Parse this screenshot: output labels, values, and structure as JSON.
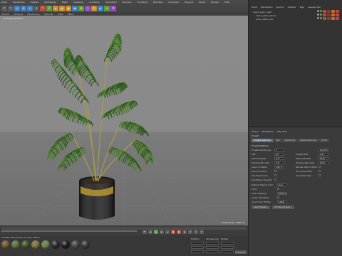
{
  "menubar": [
    "Datei",
    "Bearbeiten",
    "Objekte",
    "Werkzeuge",
    "Mesh",
    "Snapping",
    "Animation",
    "Simulation",
    "Rendern",
    "Sculpting",
    "MoGraph",
    "Charakter",
    "Plug-ins",
    "Skript",
    "Fenster",
    "Hilfe"
  ],
  "toolbar": [
    "↶",
    "↷",
    "◎",
    "✥",
    "⟲",
    "✕",
    "Y",
    "Z",
    "◈",
    "▦",
    "▣",
    "◆",
    "✿",
    "⬡",
    "⚙",
    "◐",
    "✦",
    "⚑"
  ],
  "viewport": {
    "menu": [
      "Ansicht",
      "Kameras",
      "Darstellung",
      "Optionen",
      "Filter",
      "Tafeln"
    ],
    "label": "Zentralperspektive",
    "status": "Rasterweite: 1000 cm"
  },
  "object_manager": {
    "menu": [
      "Datei",
      "Bearbeiten",
      "Ansicht",
      "Objekte",
      "Tags",
      "Lesezeichen"
    ],
    "items": [
      {
        "name": "areca_palm_plant"
      },
      {
        "name": "areca_palm_leaves"
      },
      {
        "name": "areca_palm_pot"
      }
    ]
  },
  "attributes": {
    "menu": [
      "Modus",
      "Bearbeiten",
      "Benutzer"
    ],
    "title": "Projekt",
    "tabs": [
      "Projekt-Settings",
      "Info",
      "Dynamics",
      "Referenzierung",
      "To Do"
    ],
    "section": "Projekt-Settings",
    "fields_left": [
      {
        "label": "Projekt-Skalierung",
        "value": "1"
      },
      {
        "label": "FPS",
        "value": "30"
      },
      {
        "label": "Minimale Zeit",
        "value": "0 B"
      },
      {
        "label": "Preview-Min-Zeit",
        "value": "0 B"
      },
      {
        "label": "Level of Detail",
        "value": "100 %"
      },
      {
        "label": "Use Animation",
        "value": ""
      },
      {
        "label": "Use Expression",
        "value": ""
      },
      {
        "label": "Use Motion System",
        "value": ""
      }
    ],
    "fields_right": [
      {
        "label": "",
        "value": "Zentimeter"
      },
      {
        "label": "Projekt-Zeit",
        "value": "0 B"
      },
      {
        "label": "Maximale Zeit",
        "value": "90 B"
      },
      {
        "label": "Preview-Max-Zeit",
        "value": "90 B"
      },
      {
        "label": "Render-LOD in Editor",
        "value": ""
      },
      {
        "label": "Use Generators",
        "value": ""
      },
      {
        "label": "Use Deformers",
        "value": ""
      },
      {
        "label": "",
        "value": ""
      }
    ],
    "extra_fields": [
      {
        "label": "Default Object Color",
        "value": "Grau 80%"
      },
      {
        "label": "Color",
        "value": ""
      },
      {
        "label": "View Clipping",
        "value": "Medium"
      },
      {
        "label": "Linear Workflow",
        "value": ""
      },
      {
        "label": "Input Color Profile",
        "value": "sRGB"
      }
    ],
    "buttons": [
      "Lade Preset...",
      "Sichere Preset..."
    ]
  },
  "materials": {
    "menu": [
      "Erstellen",
      "Bearbeiten",
      "Funktion",
      "Textur"
    ],
    "swatches": [
      "#7a5a2a",
      "#5f7a3a",
      "#3f5a2a",
      "#8a7a3a",
      "#6f8a4a",
      "#2b2b2b",
      "#1d1d1d",
      "#4a4a4a",
      "#3a3a3a"
    ]
  },
  "coords": {
    "labels": [
      "Position",
      "Abmessung",
      "Winkel"
    ],
    "apply": "Anwenden"
  },
  "colors": {
    "accent": "#5d6e86",
    "palm_green": "#3f6a2a",
    "pot": "#1e1e1e",
    "pot_rim": "#b8962f"
  }
}
